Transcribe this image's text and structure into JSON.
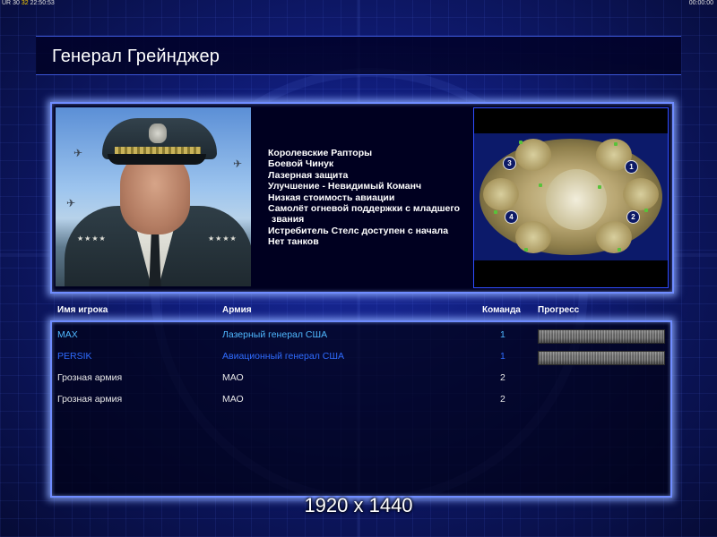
{
  "topbar": {
    "left_prefix": "UR",
    "left_value1": "30",
    "left_value2": "32",
    "left_value3": "22:50:53",
    "right_clock": "00:00:00"
  },
  "general_name": "Генерал Грейнджер",
  "perks": [
    "Королевские Рапторы",
    "Боевой Чинук",
    "Лазерная защита",
    "Улучшение - Невидимый Команч",
    "Низкая стоимость авиации",
    "Самолёт огневой поддержки с младшего",
    "звания",
    "Истребитель Стелс доступен с начала",
    "Нет танков"
  ],
  "map": {
    "spawn_labels": [
      "1",
      "2",
      "3",
      "4"
    ]
  },
  "table": {
    "headers": {
      "player": "Имя игрока",
      "army": "Армия",
      "team": "Команда",
      "progress": "Прогресс"
    },
    "rows": [
      {
        "player": "MAX",
        "army": "Лазерный генерал США",
        "team": "1",
        "progress": 1.0
      },
      {
        "player": "PERSIK",
        "army": "Авиационный генерал США",
        "team": "1",
        "progress": 1.0
      },
      {
        "player": "Грозная армия",
        "army": "МАО",
        "team": "2"
      },
      {
        "player": "Грозная армия",
        "army": "МАО",
        "team": "2"
      }
    ]
  },
  "resolution_label": "1920 x 1440",
  "colors": {
    "human_player_1": "#4fb8ff",
    "human_player_2": "#2f6cff",
    "ai_player": "#e8e8e8",
    "panel_glow": "#6f8cff"
  }
}
